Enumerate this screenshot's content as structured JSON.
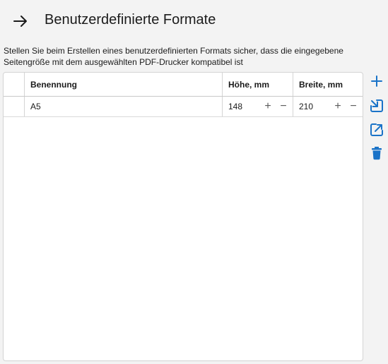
{
  "header": {
    "title": "Benutzerdefinierte Formate",
    "back_icon": "arrow-right-icon"
  },
  "info_text": "Stellen Sie beim Erstellen eines benutzerdefinierten Formats sicher, dass die eingegebene Seitengröße mit dem ausgewählten PDF-Drucker kompatibel ist",
  "table": {
    "columns": [
      "",
      "Benennung",
      "Höhe, mm",
      "Breite, mm"
    ],
    "rows": [
      {
        "name": "A5",
        "height": "148",
        "width": "210"
      }
    ]
  },
  "steppers": {
    "plus": "+",
    "minus": "−"
  },
  "side_actions": [
    {
      "icon": "plus-icon",
      "name": "add-format-button"
    },
    {
      "icon": "import-icon",
      "name": "import-button"
    },
    {
      "icon": "export-icon",
      "name": "export-button"
    },
    {
      "icon": "trash-icon",
      "name": "delete-button"
    }
  ],
  "colors": {
    "accent": "#1a73c8",
    "background": "#f3f3f3",
    "grid_border": "#d4d4d4"
  }
}
